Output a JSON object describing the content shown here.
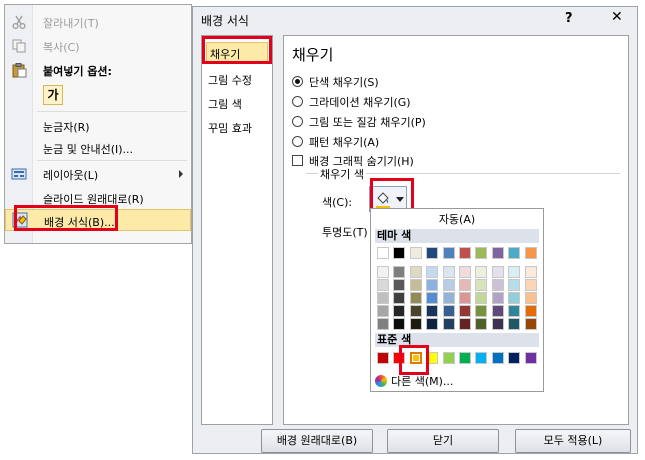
{
  "context_menu": {
    "cut": "잘라내기(T)",
    "copy": "복사(C)",
    "paste_options": "붙여넣기 옵션:",
    "paste_keep_text": "가",
    "ruler": "눈금자(R)",
    "grid_guides": "눈금 및 안내선(I)...",
    "layout": "레이아웃(L)",
    "reset_slide": "슬라이드 원래대로(R)",
    "format_background": "배경 서식(B)..."
  },
  "dialog": {
    "title": "배경 서식",
    "help": "?",
    "close": "✕",
    "categories": [
      "채우기",
      "그림 수정",
      "그림 색",
      "꾸밈 효과"
    ],
    "selected_category": "채우기",
    "section_title": "채우기",
    "fill_options": [
      "단색 채우기(S)",
      "그라데이션 채우기(G)",
      "그림 또는 질감 채우기(P)",
      "패턴 채우기(A)"
    ],
    "selected_fill": "단색 채우기(S)",
    "hide_graphics": "배경 그래픽 숨기기(H)",
    "fill_color_group": "채우기 색",
    "color_label": "색(C):",
    "transparency_label": "투명도(T)",
    "buttons": {
      "reset": "배경 원래대로(B)",
      "close": "닫기",
      "apply_all": "모두 적용(L)"
    }
  },
  "color_picker": {
    "automatic": "자동(A)",
    "theme_colors_header": "테마 색",
    "standard_colors_header": "표준 색",
    "more_colors": "다른 색(M)...",
    "theme_colors": [
      [
        "#ffffff",
        "#f2f2f2",
        "#d9d9d9",
        "#bfbfbf",
        "#a6a6a6",
        "#808080"
      ],
      [
        "#000000",
        "#7f7f7f",
        "#595959",
        "#404040",
        "#262626",
        "#0d0d0d"
      ],
      [
        "#eeece1",
        "#ddd9c3",
        "#c4bd97",
        "#948a54",
        "#4a452a",
        "#1d1b10"
      ],
      [
        "#1f497d",
        "#c6d9f1",
        "#8db3e2",
        "#548dd4",
        "#17365d",
        "#0f243e"
      ],
      [
        "#4f81bd",
        "#dbe5f1",
        "#b8cce4",
        "#95b3d7",
        "#366092",
        "#244061"
      ],
      [
        "#c0504d",
        "#f2dcdb",
        "#e6b9b8",
        "#d99694",
        "#953734",
        "#632423"
      ],
      [
        "#9bbb59",
        "#ebf1dd",
        "#d7e3bc",
        "#c3d69b",
        "#76923c",
        "#4f6128"
      ],
      [
        "#8064a2",
        "#e5e0ec",
        "#ccc1d9",
        "#b2a2c7",
        "#5f497a",
        "#3f3151"
      ],
      [
        "#4bacc6",
        "#dbeef3",
        "#b7dde8",
        "#92cddc",
        "#31859b",
        "#205867"
      ],
      [
        "#f79646",
        "#fdeada",
        "#fbd5b5",
        "#fac08f",
        "#e36c09",
        "#974806"
      ]
    ],
    "standard_colors": [
      "#c00000",
      "#ff0000",
      "#ffc000",
      "#ffff00",
      "#92d050",
      "#00b050",
      "#00b0f0",
      "#0070c0",
      "#002060",
      "#7030a0"
    ],
    "selected_standard_color": "#ffc000"
  },
  "colors": {
    "highlight": "#fde9a8",
    "annotation_red": "#e3001b"
  }
}
